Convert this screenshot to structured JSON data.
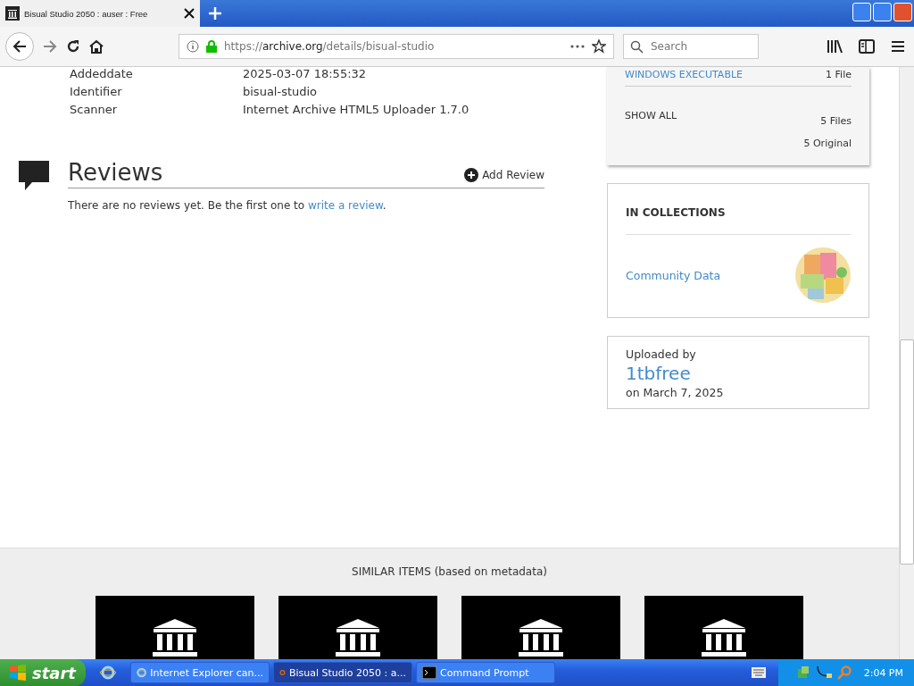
{
  "browser": {
    "tab": {
      "title": "Bisual Studio 2050 : auser : Free",
      "selected": true
    },
    "url": {
      "scheme": "https://",
      "host": "archive.org",
      "path": "/details/bisual-studio"
    },
    "search": {
      "placeholder": "Search"
    }
  },
  "metadata": [
    {
      "label": "Addeddate",
      "value": "2025-03-07 18:55:32"
    },
    {
      "label": "Identifier",
      "value": "bisual-studio"
    },
    {
      "label": "Scanner",
      "value": "Internet Archive HTML5 Uploader 1.7.0"
    }
  ],
  "reviews": {
    "title": "Reviews",
    "add": "Add Review",
    "text": "There are no reviews yet. Be the first one to ",
    "link": "write a review",
    "end": "."
  },
  "files": {
    "rows": [
      {
        "label": "WINDOWS EXECUTABLE",
        "count": "1 File"
      }
    ],
    "show_all": "SHOW ALL",
    "total": "5 Files",
    "original": "5 Original"
  },
  "collections": {
    "heading": "IN COLLECTIONS",
    "items": [
      {
        "name": "Community Data"
      }
    ]
  },
  "uploader": {
    "label": "Uploaded by",
    "name": "1tbfree",
    "date": "on March 7, 2025"
  },
  "similar": {
    "title": "SIMILAR ITEMS (based on metadata)",
    "cards": [
      {
        "kind": "collection"
      },
      {
        "kind": "collection"
      },
      {
        "kind": "collection"
      },
      {
        "kind": "collection"
      }
    ]
  },
  "taskbar": {
    "start": "start",
    "tasks": [
      {
        "label": "Internet Explorer can...",
        "kind": "ie",
        "selected": false
      },
      {
        "label": "Bisual Studio 2050 : a...",
        "kind": "firefox",
        "selected": true
      },
      {
        "label": "Command Prompt",
        "kind": "cmd",
        "selected": false
      }
    ],
    "clock": "2:04 PM"
  }
}
